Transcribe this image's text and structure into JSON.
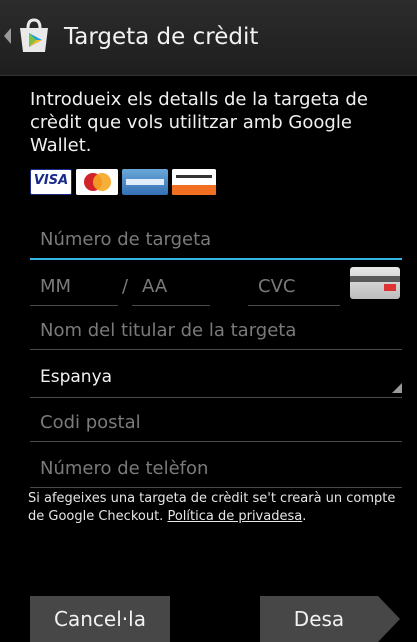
{
  "action_bar": {
    "title": "Targeta de crèdit"
  },
  "intro": "Introdueix els detalls de la targeta de crèdit que vols utilitzar amb Google Wallet.",
  "cards": {
    "visa_label": "VISA",
    "accepted": [
      "visa-card-icon",
      "mastercard-card-icon",
      "amex-card-icon",
      "discover-card-icon"
    ]
  },
  "form": {
    "card_number_placeholder": "Número de targeta",
    "month_placeholder": "MM",
    "separator": "/",
    "year_placeholder": "AA",
    "cvc_placeholder": "CVC",
    "cardholder_placeholder": "Nom del titular de la targeta",
    "country_value": "Espanya",
    "postal_placeholder": "Codi postal",
    "phone_placeholder": "Número de telèfon"
  },
  "notice": {
    "text": "Si afegeixes una targeta de crèdit se't crearà un compte de Google Checkout. ",
    "link": "Política de privadesa",
    "end": "."
  },
  "buttons": {
    "cancel": "Cancel·la",
    "save": "Desa"
  },
  "colors": {
    "accent": "#33b5e5",
    "button": "#474747"
  }
}
